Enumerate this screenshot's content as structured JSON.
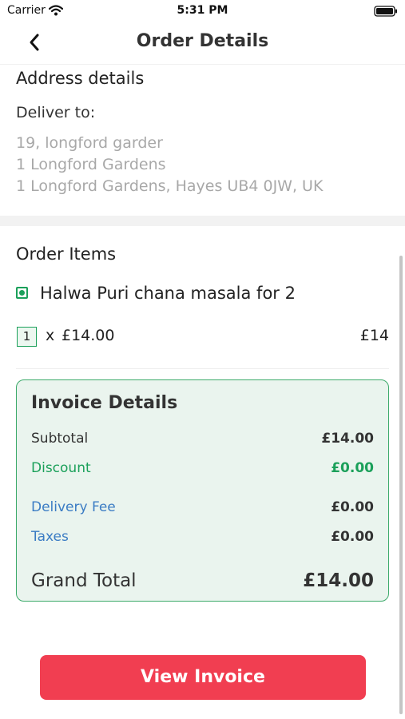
{
  "status_bar": {
    "carrier": "Carrier",
    "time": "5:31 PM"
  },
  "header": {
    "title": "Order Details"
  },
  "address": {
    "heading": "Address details",
    "deliver_label": "Deliver to:",
    "lines": [
      "19, longford garder",
      "1 Longford Gardens",
      "1 Longford Gardens, Hayes UB4 0JW, UK"
    ]
  },
  "order_items": {
    "heading": "Order Items",
    "items": [
      {
        "name": "Halwa Puri chana masala for 2",
        "quantity": "1",
        "times": "x",
        "unit_price": "£14.00",
        "line_total": "£14"
      }
    ]
  },
  "invoice": {
    "title": "Invoice Details",
    "rows": [
      {
        "label": "Subtotal",
        "value": "£14.00"
      },
      {
        "label": "Discount",
        "value": "£0.00"
      },
      {
        "label": "Delivery Fee",
        "value": "£0.00"
      },
      {
        "label": "Taxes",
        "value": "£0.00"
      }
    ],
    "grand_total_label": "Grand Total",
    "grand_total_value": "£14.00"
  },
  "actions": {
    "view_invoice_label": "View Invoice"
  },
  "colors": {
    "accent_red": "#f13e51",
    "veg_green": "#1ba05a",
    "discount_green": "#1ba05a",
    "link_blue": "#3b7cc4",
    "card_background": "#eaf4ee",
    "card_border": "#3caa6a"
  },
  "icons": [
    "wifi-icon",
    "battery-icon",
    "back-chevron-icon",
    "veg-indicator-icon"
  ]
}
